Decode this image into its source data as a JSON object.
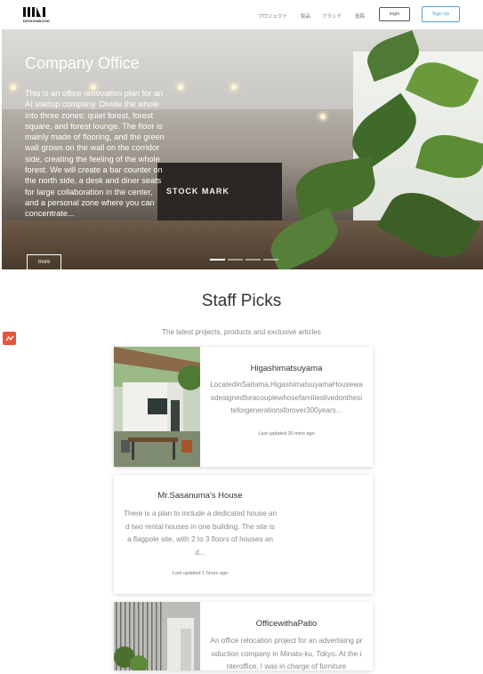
{
  "header": {
    "logo_text": "DESIGNBOOK",
    "nav": [
      "プロジェクト",
      "製品",
      "ブランド",
      "投稿"
    ],
    "login_label": "login",
    "signup_label": "Sign Up"
  },
  "hero": {
    "title": "Company Office",
    "description": "This is an office renovation plan for an AI startup company. Divide the whole into three zones: quiet forest, forest square, and forest lounge. The floor is mainly made of flooring, and the green wall grows on the wall on the corridor side, creating the feeling of the whole forest. We will create a bar counter on the north side, a desk and diner seats for large collaboration in the center, and a personal zone where you can concentrate...",
    "more_label": "more",
    "sign_text": "STOCK MARK"
  },
  "staff_picks": {
    "title": "Staff Picks",
    "subtitle": "The latest projects, products and exclusive articles",
    "cards": [
      {
        "title": "Higashimatsuyama",
        "text": "LocatedinSaitama,HigashimatsuyamaHousewasdesignedforacouplewhosefamilieslivedonthesiteforgenerationsforover300years...",
        "updated": "Last updated 30 mins ago"
      },
      {
        "title": "Mr.Sasanuma's House",
        "text": "There is a plan to include a dedicated house and two rental houses in one building. The site is a flagpole site, with 2 to 3 floors of houses and...",
        "updated": "Last updated 1 hours ago"
      },
      {
        "title": "OfficewithaPatio",
        "text": "An office relocation project for an advertising production company in Minato-ku, Tokyo. At the interoffice, I was in charge of furniture"
      }
    ]
  },
  "colors": {
    "accent": "#4aa3df",
    "badge": "#e8553b"
  }
}
